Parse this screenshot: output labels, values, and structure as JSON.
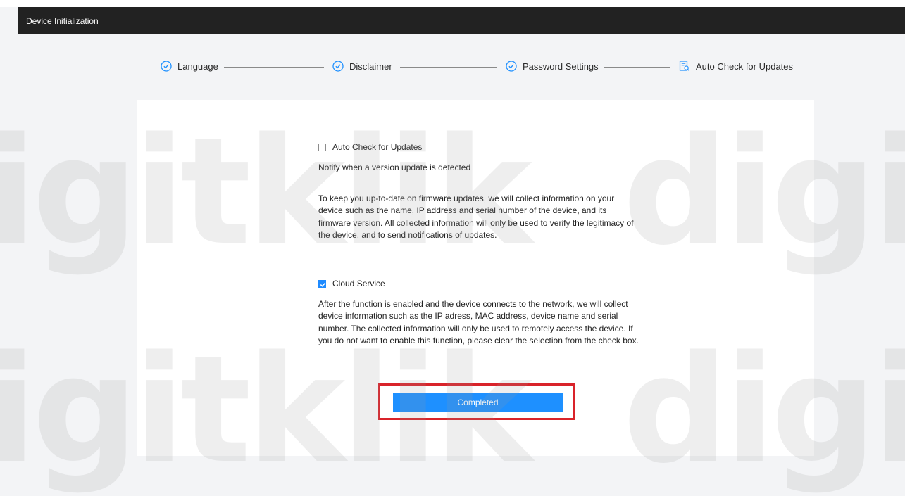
{
  "window": {
    "title": "Device Initialization"
  },
  "steps": [
    {
      "label": "Language",
      "icon": "check-circle-icon",
      "state": "done"
    },
    {
      "label": "Disclaimer",
      "icon": "check-circle-icon",
      "state": "done"
    },
    {
      "label": "Password Settings",
      "icon": "check-circle-icon",
      "state": "done"
    },
    {
      "label": "Auto Check for Updates",
      "icon": "search-document-icon",
      "state": "current"
    }
  ],
  "auto_update": {
    "checkbox_label": "Auto Check for Updates",
    "checked": false,
    "subtitle": "Notify when a version update is detected",
    "description": "To keep you up-to-date on firmware updates, we will collect information on your device such as the name, IP address and serial number of the device, and its firmware version. All collected information will only be used to verify the legitimacy of the device, and to send notifications of updates."
  },
  "cloud_service": {
    "checkbox_label": "Cloud Service",
    "checked": true,
    "description": "After the function is enabled and the device connects to the network, we will collect device information such as the IP adress, MAC address, device name and serial number. The collected information will only be used to remotely access the device. If you do not want to enable this function, please clear the selection from the check box."
  },
  "actions": {
    "complete_label": "Completed"
  },
  "colors": {
    "accent": "#1e90ff",
    "title_bar": "#222222",
    "highlight": "#d9232a"
  }
}
